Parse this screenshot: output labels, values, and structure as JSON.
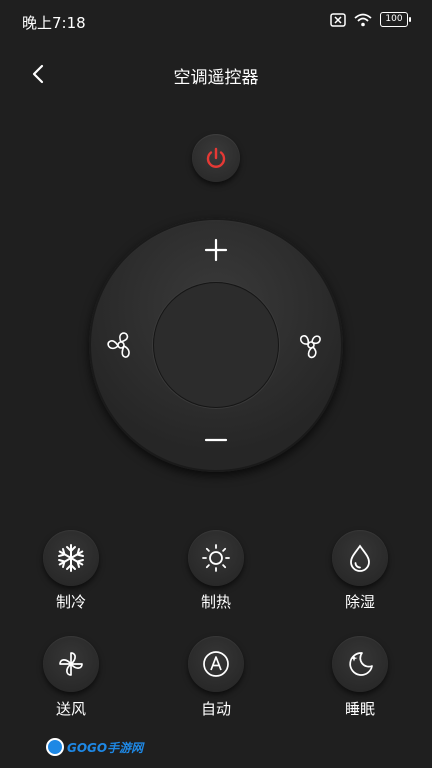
{
  "status_bar": {
    "time": "晚上7:18",
    "battery": "100",
    "icons": [
      "sim-error-icon",
      "wifi-icon",
      "battery-icon"
    ]
  },
  "header": {
    "title": "空调遥控器",
    "back_icon": "chevron-left-icon"
  },
  "power": {
    "icon": "power-icon",
    "color": "#e53935"
  },
  "dial": {
    "up_icon": "plus-icon",
    "down_icon": "minus-icon",
    "left_icon": "fan-icon",
    "right_icon": "fan-icon"
  },
  "modes": [
    {
      "label": "制冷",
      "icon": "snowflake-icon"
    },
    {
      "label": "制热",
      "icon": "sun-icon"
    },
    {
      "label": "除湿",
      "icon": "droplet-icon"
    },
    {
      "label": "送风",
      "icon": "pinwheel-icon"
    },
    {
      "label": "自动",
      "icon": "auto-a-icon"
    },
    {
      "label": "睡眠",
      "icon": "moon-star-icon"
    }
  ],
  "watermark": {
    "text": "GOGO手游网"
  },
  "colors": {
    "background": "#1f1f1f",
    "accent_red": "#e53935",
    "watermark_blue": "#1e88e5"
  }
}
